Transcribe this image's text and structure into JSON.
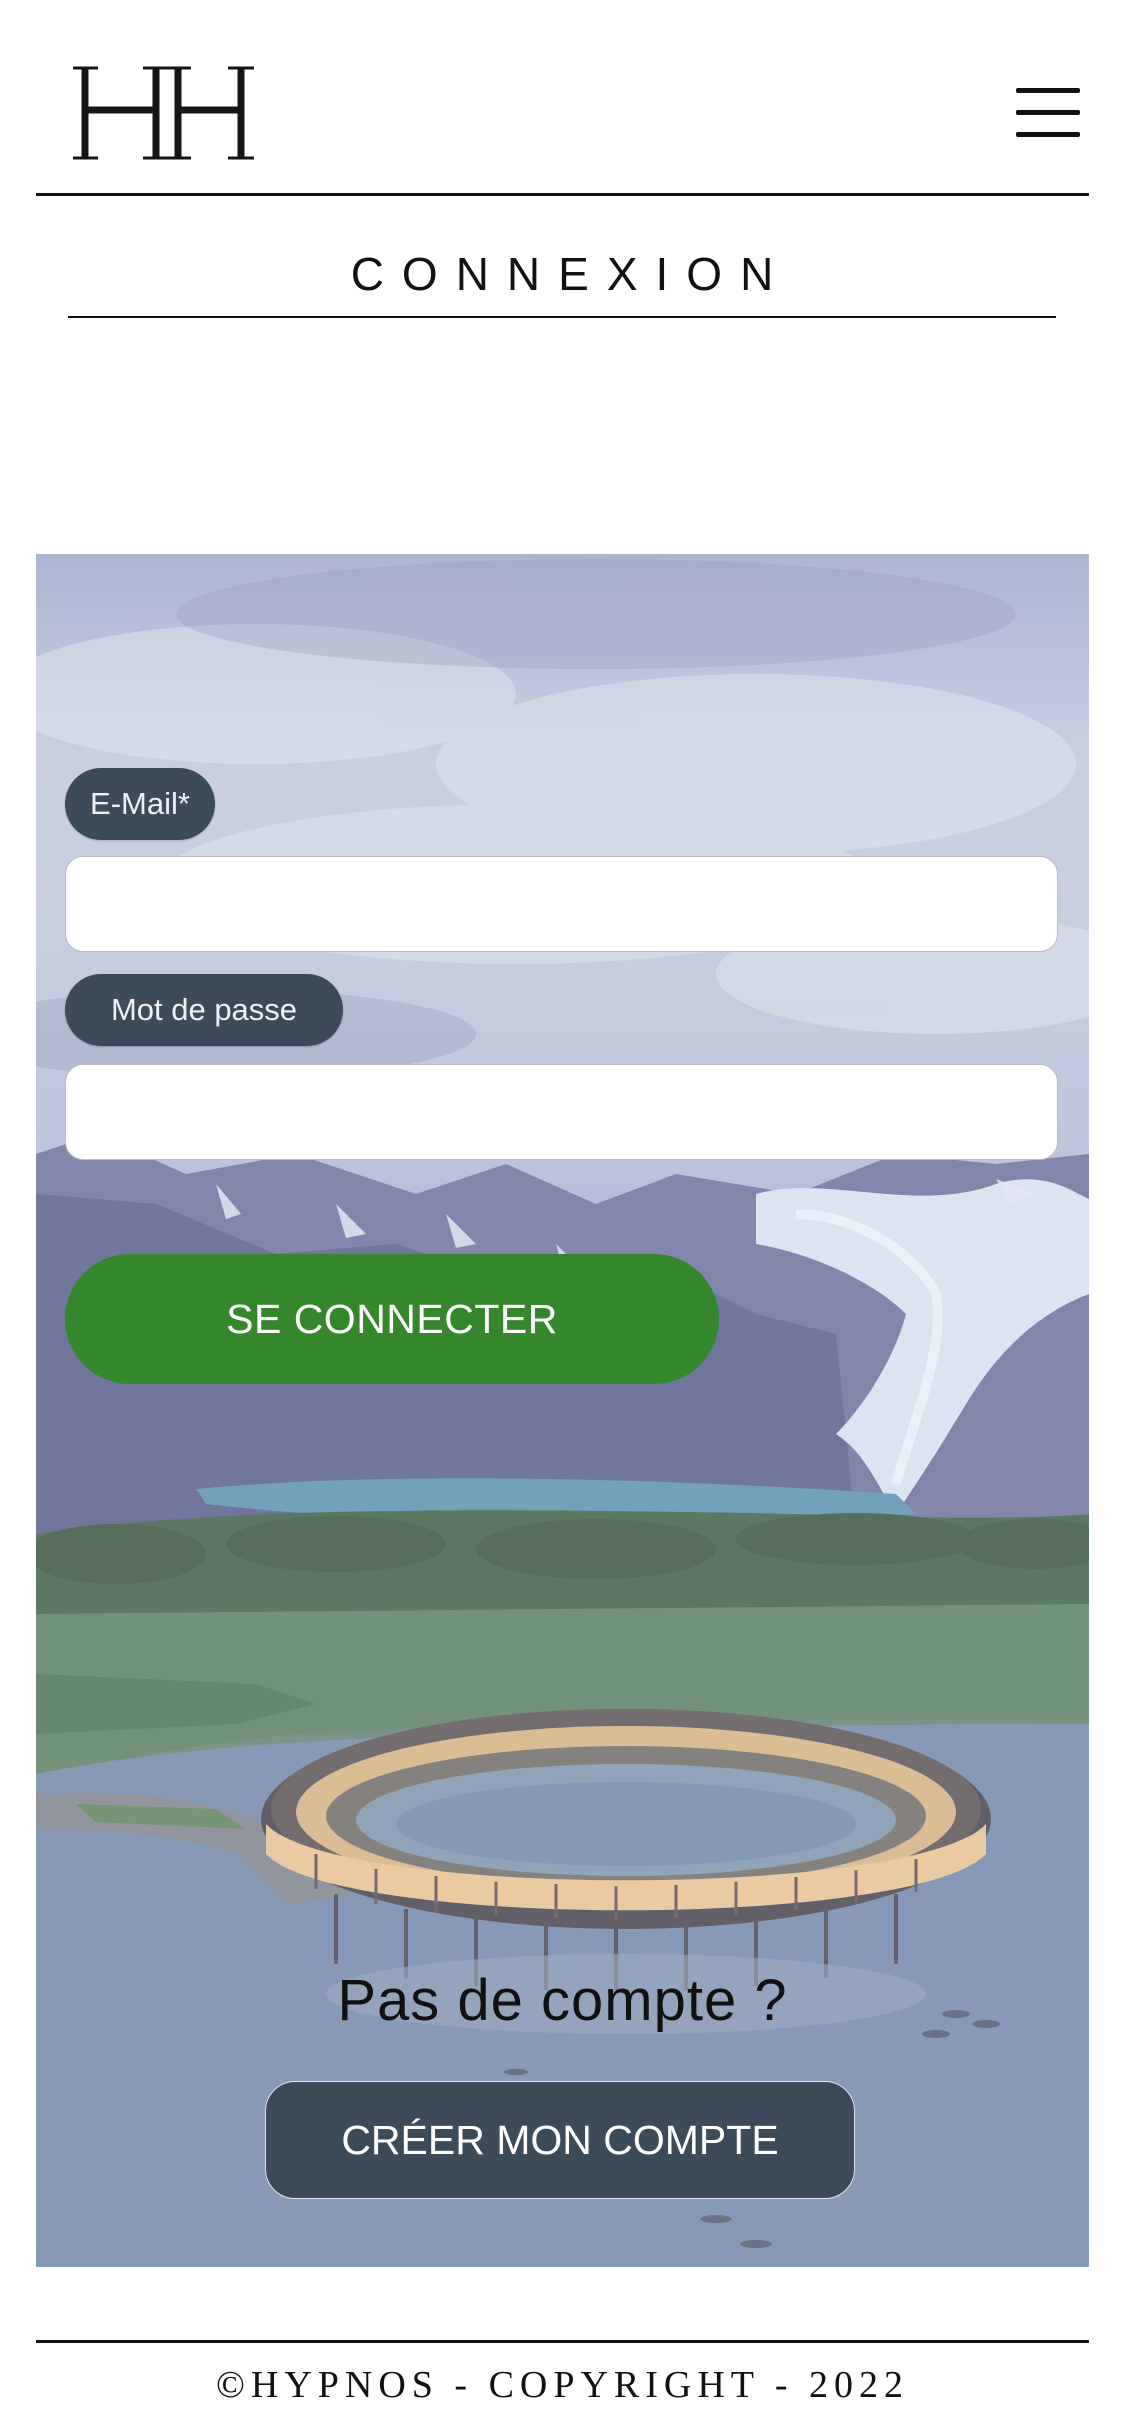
{
  "header": {
    "logo_text": "HH",
    "menu_icon": "hamburger-menu-icon"
  },
  "page": {
    "title": "CONNEXION"
  },
  "form": {
    "email_label": "E-Mail*",
    "email_value": "",
    "password_label": "Mot de passe",
    "password_value": "",
    "submit_label": "SE CONNECTER"
  },
  "signup": {
    "prompt": "Pas de compte ?",
    "button_label": "CRÉER MON COMPTE"
  },
  "footer": {
    "copyright": "©HYPNOS - COPYRIGHT - 2022"
  },
  "colors": {
    "submit_button": "#35872b",
    "label_pill": "#3c4b59",
    "create_button": "#3c4b59"
  }
}
